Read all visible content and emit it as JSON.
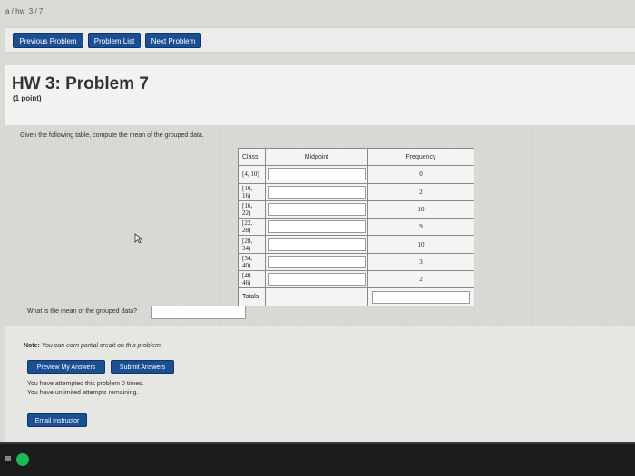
{
  "breadcrumb": "a / hw_3 / 7",
  "nav": {
    "previous": "Previous Problem",
    "list": "Problem List",
    "next": "Next Problem"
  },
  "problem": {
    "title": "HW 3: Problem 7",
    "points": "(1 point)",
    "prompt": "Given the following table, compute the mean of the grouped data.",
    "table": {
      "headers": [
        "Class",
        "Midpoint",
        "Frequency"
      ],
      "rows": [
        {
          "class": "[4, 10)",
          "frequency": "0"
        },
        {
          "class": "[10, 16)",
          "frequency": "2"
        },
        {
          "class": "[16, 22)",
          "frequency": "10"
        },
        {
          "class": "[22, 28)",
          "frequency": "9"
        },
        {
          "class": "[28, 34)",
          "frequency": "10"
        },
        {
          "class": "[34, 40)",
          "frequency": "3"
        },
        {
          "class": "[40, 46)",
          "frequency": "2"
        }
      ],
      "totals_label": "Totals"
    },
    "mean_question": "What is the mean of the grouped data?"
  },
  "footer": {
    "note_label": "Note:",
    "note_text": "You can earn partial credit on this problem.",
    "preview_button": "Preview My Answers",
    "submit_button": "Submit Answers",
    "attempted": "You have attempted this problem 0 times.",
    "remaining": "You have unlimited attempts remaining.",
    "email_button": "Email Instructor"
  },
  "colors": {
    "button_blue": "#1b4f93",
    "taskbar": "#1c1c1e",
    "spotify_green": "#1db954"
  },
  "icons": [
    "cursor-icon",
    "spotify-icon",
    "start-icon"
  ]
}
